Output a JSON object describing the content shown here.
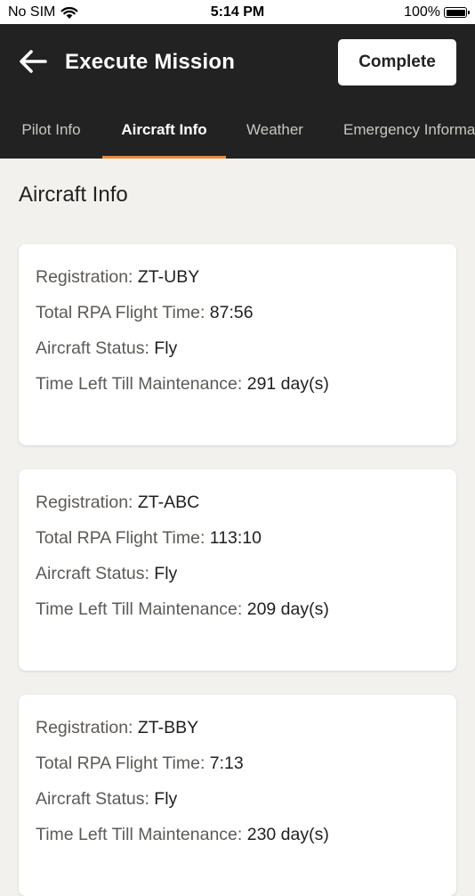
{
  "status_bar": {
    "carrier": "No SIM",
    "time": "5:14 PM",
    "battery": "100%"
  },
  "header": {
    "title": "Execute Mission",
    "complete_label": "Complete"
  },
  "tabs": [
    {
      "label": "Pilot Info",
      "active": false
    },
    {
      "label": "Aircraft Info",
      "active": true
    },
    {
      "label": "Weather",
      "active": false
    },
    {
      "label": "Emergency Information",
      "active": false
    }
  ],
  "section": {
    "title": "Aircraft Info"
  },
  "aircraft": [
    {
      "registration_label": "Registration:",
      "registration": "ZT-UBY",
      "flight_time_label": "Total RPA Flight Time:",
      "flight_time": "87:56",
      "status_label": "Aircraft Status:",
      "status": "Fly",
      "maintenance_label": "Time Left Till Maintenance:",
      "maintenance": "291 day(s)"
    },
    {
      "registration_label": "Registration:",
      "registration": "ZT-ABC",
      "flight_time_label": "Total RPA Flight Time:",
      "flight_time": "113:10",
      "status_label": "Aircraft Status:",
      "status": "Fly",
      "maintenance_label": "Time Left Till Maintenance:",
      "maintenance": "209 day(s)"
    },
    {
      "registration_label": "Registration:",
      "registration": "ZT-BBY",
      "flight_time_label": "Total RPA Flight Time:",
      "flight_time": "7:13",
      "status_label": "Aircraft Status:",
      "status": "Fly",
      "maintenance_label": "Time Left Till Maintenance:",
      "maintenance": "230 day(s)"
    }
  ],
  "colors": {
    "header_bg": "#222222",
    "tab_indicator": "#e88a3c",
    "page_bg": "#f2f1ee"
  }
}
